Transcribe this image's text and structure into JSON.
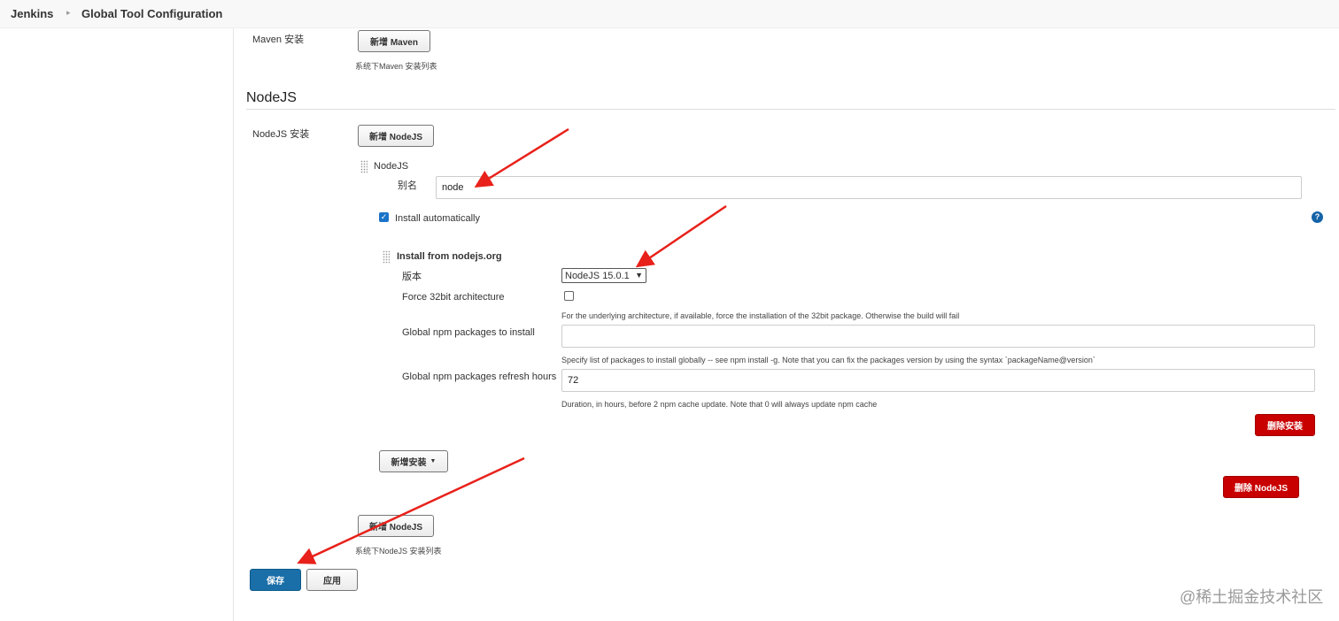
{
  "breadcrumb": {
    "root": "Jenkins",
    "current": "Global Tool Configuration"
  },
  "maven": {
    "install_label": "Maven 安装",
    "add_button": "新增 Maven",
    "help": "系统下Maven 安装列表"
  },
  "nodejs": {
    "section_title": "NodeJS",
    "install_label": "NodeJS 安装",
    "add_button": "新增 NodeJS",
    "item_header": "NodeJS",
    "alias_label": "别名",
    "alias_value": "node",
    "install_automatically_label": "Install automatically",
    "install_automatically_checked": true,
    "installer": {
      "title": "Install from nodejs.org",
      "version_label": "版本",
      "version_value": "NodeJS 15.0.1",
      "force32_label": "Force 32bit architecture",
      "force32_checked": false,
      "force32_help": "For the underlying architecture, if available, force the installation of the 32bit package. Otherwise the build will fail",
      "global_npm_label": "Global npm packages to install",
      "global_npm_value": "",
      "global_npm_help": "Specify list of packages to install globally -- see npm install -g. Note that you can fix the packages version by using the syntax `packageName@version`",
      "refresh_label": "Global npm packages refresh hours",
      "refresh_value": "72",
      "refresh_help": "Duration, in hours, before 2 npm cache update. Note that 0 will always update npm cache",
      "delete_button": "删除安装"
    },
    "add_installer_button": "新增安装",
    "delete_nodejs_button": "删除 NodeJS",
    "add_button_bottom": "新增 NodeJS",
    "help_bottom": "系统下NodeJS 安装列表"
  },
  "footer": {
    "save_button": "保存",
    "apply_button": "应用"
  },
  "watermark": "@稀土掘金技术社区",
  "colors": {
    "save_blue": "#1a6fa8",
    "delete_red": "#c80000",
    "arrow_red": "#e8211a",
    "checkbox_blue": "#1a73c8"
  },
  "icons": {
    "help": "help-icon",
    "crumb_separator": "chevron-right-icon",
    "dropdown": "chevron-down-icon"
  }
}
